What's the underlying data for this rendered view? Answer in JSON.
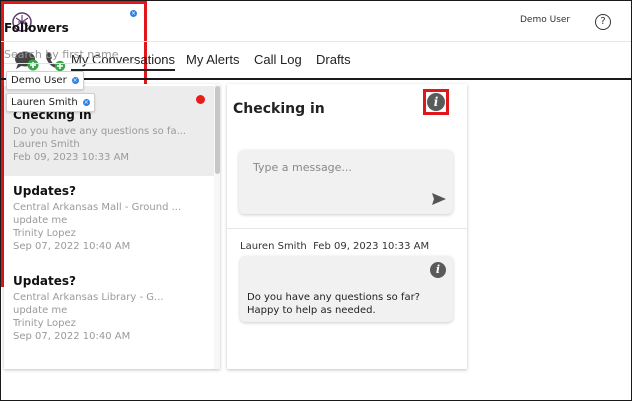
{
  "header": {
    "user_name": "Demo User",
    "help_icon": "question-icon",
    "logo_icon": "brand-logo-icon"
  },
  "nav": {
    "icons": [
      "chat-add-icon",
      "phone-add-icon"
    ],
    "tabs": [
      {
        "label": "My Conversations",
        "active": true
      },
      {
        "label": "My Alerts",
        "active": false
      },
      {
        "label": "Call Log",
        "active": false
      },
      {
        "label": "Drafts",
        "active": false
      }
    ]
  },
  "conversations": [
    {
      "title": "Checking in",
      "preview": "Do you have any questions so fa...",
      "author": "Lauren Smith",
      "date": "Feb 09, 2023 10:33 AM",
      "unread": true,
      "active": true
    },
    {
      "title": "Updates?",
      "location": "Central Arkansas Mall - Ground ...",
      "preview": "update me",
      "author": "Trinity Lopez",
      "date": "Sep 07, 2022 10:40 AM",
      "unread": false,
      "active": false
    },
    {
      "title": "Updates?",
      "location": "Central Arkansas Library - G...",
      "preview": "update me",
      "author": "Trinity Lopez",
      "date": "Sep 07, 2022 10:40 AM",
      "unread": false,
      "active": false
    }
  ],
  "conversation": {
    "title": "Checking in",
    "message_placeholder": "Type a message...",
    "messages": [
      {
        "author": "Lauren Smith",
        "date": "Feb 09, 2023 10:33 AM",
        "text_lines": [
          "Do you have any questions so far?",
          "Happy to help as needed."
        ]
      }
    ]
  },
  "followers": {
    "title": "Followers",
    "search_placeholder": "Search by first name",
    "list": [
      {
        "name": "Demo User"
      },
      {
        "name": "Lauren Smith"
      }
    ]
  },
  "colors": {
    "highlight_red": "#e0161b",
    "unread_dot": "#ea1b1b",
    "chip_remove_blue": "#2f7fe0",
    "nav_add_green": "#3aa84a"
  }
}
